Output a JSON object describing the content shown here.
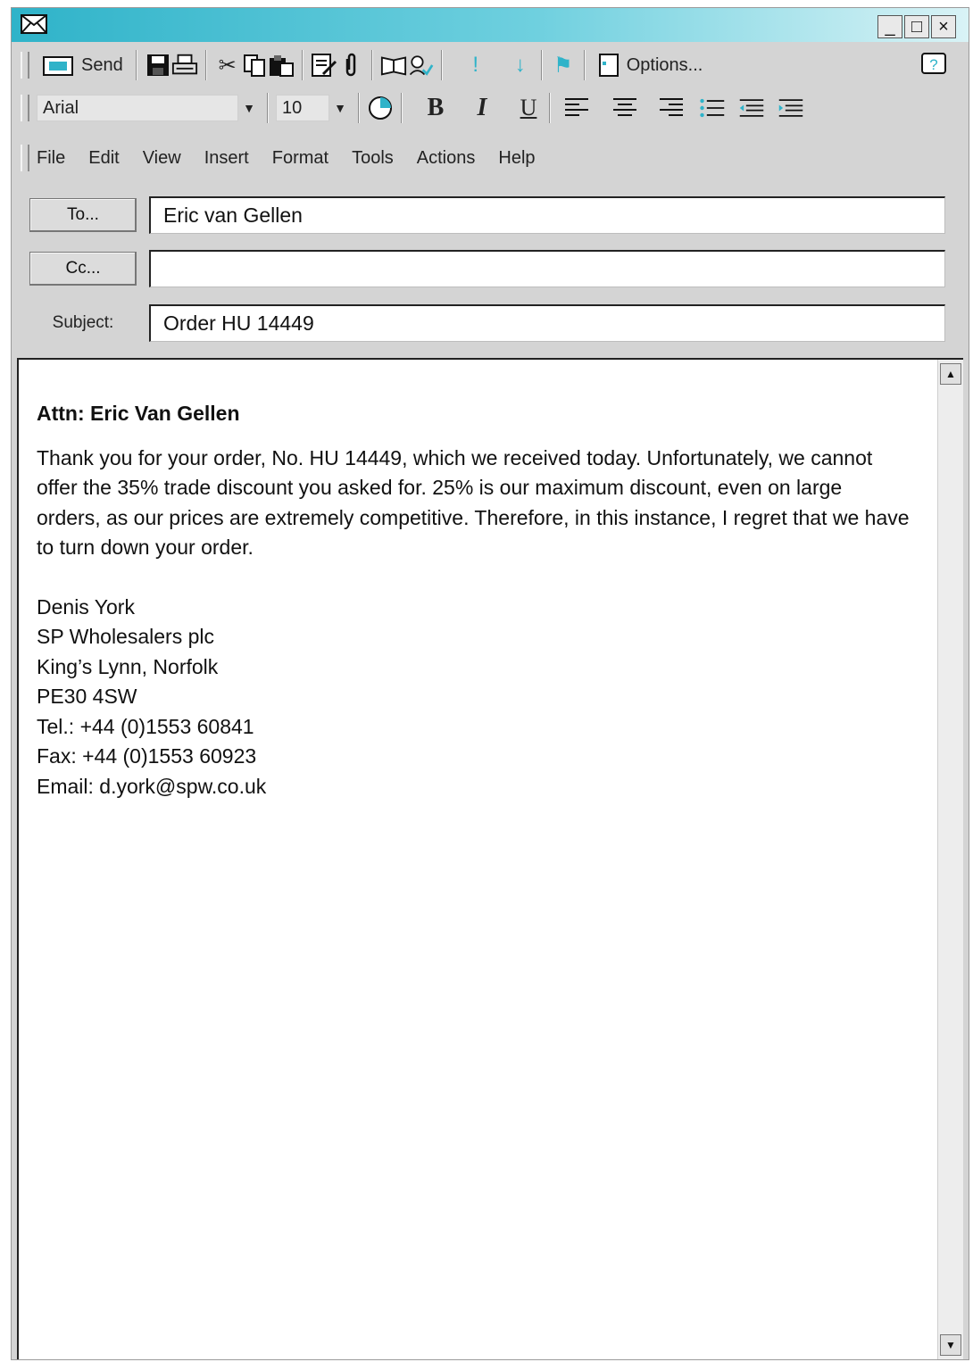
{
  "window": {
    "controls": {
      "minimize": "_",
      "maximize": "□",
      "close": "×"
    }
  },
  "toolbar": {
    "send_label": "Send",
    "options_label": "Options..."
  },
  "format_bar": {
    "font": "Arial",
    "size": "10",
    "bold": "B",
    "italic": "I",
    "underline": "U"
  },
  "menu": [
    "File",
    "Edit",
    "View",
    "Insert",
    "Format",
    "Tools",
    "Actions",
    "Help"
  ],
  "fields": {
    "to_button": "To...",
    "to_value": "Eric van Gellen",
    "cc_button": "Cc...",
    "cc_value": "",
    "subject_label": "Subject:",
    "subject_value": "Order HU 14449"
  },
  "message": {
    "attn": "Attn: Eric Van Gellen",
    "paragraph": "Thank you for your order, No. HU 14449, which we received today. Unfortunately, we cannot offer the 35% trade discount you asked for. 25% is our maximum discount, even on large orders, as our prices are extremely competitive. Therefore, in this instance, I regret that we have to turn down your order.",
    "signature": [
      "Denis York",
      "SP Wholesalers plc",
      "King’s Lynn, Norfolk",
      "PE30 4SW",
      "Tel.: +44 (0)1553 60841",
      "Fax: +44 (0)1553 60923",
      "Email: d.york@spw.co.uk"
    ]
  },
  "colors": {
    "titlebar": "#2fb3c9",
    "accent": "#2fb3c9"
  }
}
